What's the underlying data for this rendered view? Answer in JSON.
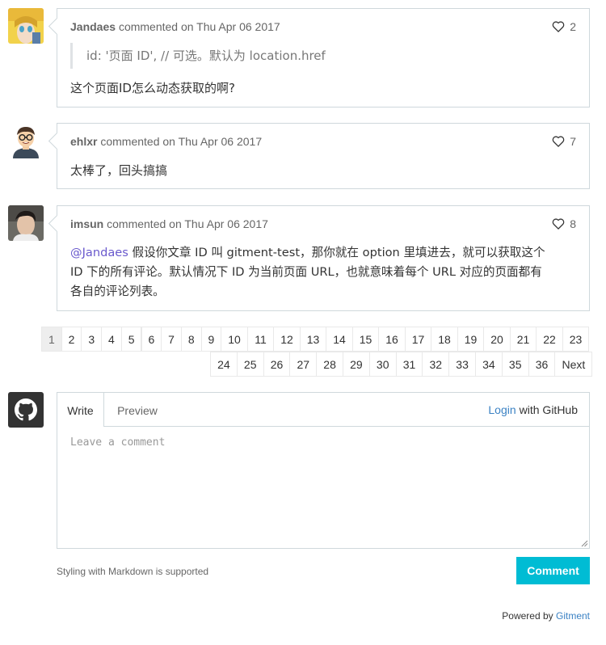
{
  "comments": [
    {
      "author": "Jandaes",
      "meta": "commented on Thu Apr 06 2017",
      "likes": "2",
      "quote": "id: '页面 ID', // 可选。默认为 location.href",
      "text": "这个页面ID怎么动态获取的啊?"
    },
    {
      "author": "ehlxr",
      "meta": "commented on Thu Apr 06 2017",
      "likes": "7",
      "text": "太棒了，回头搞搞"
    },
    {
      "author": "imsun",
      "meta": "commented on Thu Apr 06 2017",
      "likes": "8",
      "mention": "@Jandaes",
      "line1": " 假设你文章 ID 叫 gitment-test，那你就在 option 里填进去，就可以获取这个",
      "line2": "ID 下的所有评论。默认情况下 ID 为当前页面 URL，也就意味着每个 URL 对应的页面都有",
      "line3": "各自的评论列表。"
    }
  ],
  "pagination": {
    "row1": [
      "1",
      "2",
      "3",
      "4",
      "5",
      "6",
      "7",
      "8",
      "9",
      "10",
      "11",
      "12",
      "13",
      "14",
      "15",
      "16",
      "17",
      "18",
      "19",
      "20",
      "21",
      "22",
      "23"
    ],
    "row2": [
      "24",
      "25",
      "26",
      "27",
      "28",
      "29",
      "30",
      "31",
      "32",
      "33",
      "34",
      "35",
      "36",
      "Next"
    ],
    "active": "1"
  },
  "editor": {
    "tab_write": "Write",
    "tab_preview": "Preview",
    "login_link": "Login",
    "login_suffix": "with GitHub",
    "placeholder": "Leave a comment",
    "markdown_note": "Styling with Markdown is supported",
    "submit_label": "Comment"
  },
  "footer": {
    "powered_prefix": "Powered by",
    "powered_link": "Gitment"
  },
  "colors": {
    "accent": "#00bcd4",
    "link": "#3b82c4",
    "mention": "#6a5acd",
    "border": "#cfd8dc"
  }
}
